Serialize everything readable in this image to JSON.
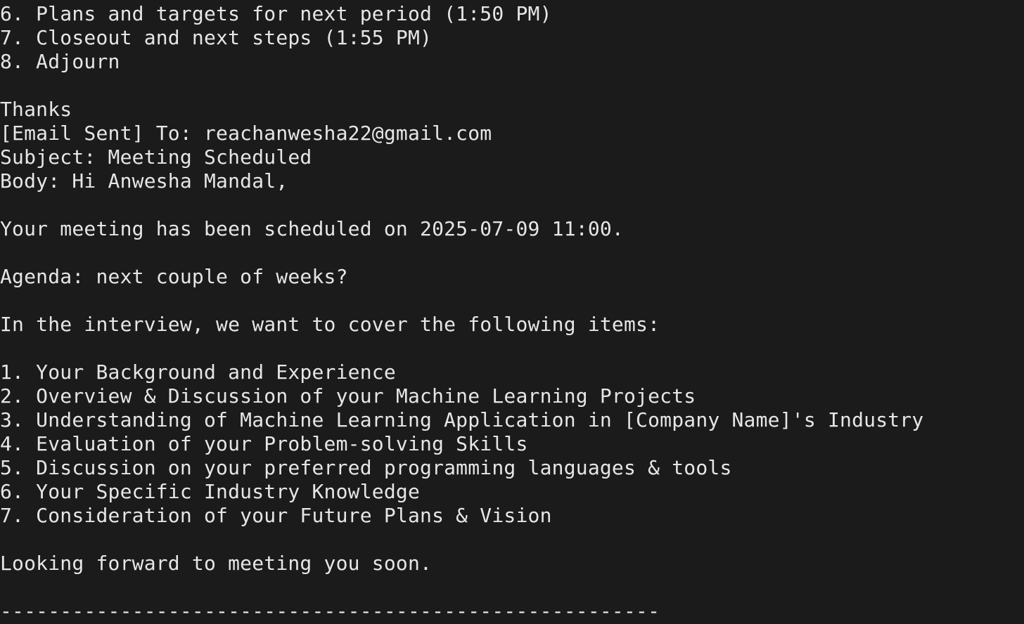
{
  "terminal": {
    "lines": [
      "6. Plans and targets for next period (1:50 PM)",
      "7. Closeout and next steps (1:55 PM)",
      "8. Adjourn",
      "",
      "Thanks",
      "[Email Sent] To: reachanwesha22@gmail.com",
      "Subject: Meeting Scheduled",
      "Body: Hi Anwesha Mandal,",
      "",
      "Your meeting has been scheduled on 2025-07-09 11:00.",
      "",
      "Agenda: next couple of weeks?",
      "",
      "In the interview, we want to cover the following items:",
      "",
      "1. Your Background and Experience",
      "2. Overview & Discussion of your Machine Learning Projects",
      "3. Understanding of Machine Learning Application in [Company Name]'s Industry",
      "4. Evaluation of your Problem-solving Skills",
      "5. Discussion on your preferred programming languages & tools",
      "6. Your Specific Industry Knowledge",
      "7. Consideration of your Future Plans & Vision",
      "",
      "Looking forward to meeting you soon.",
      "",
      "-------------------------------------------------------"
    ]
  }
}
